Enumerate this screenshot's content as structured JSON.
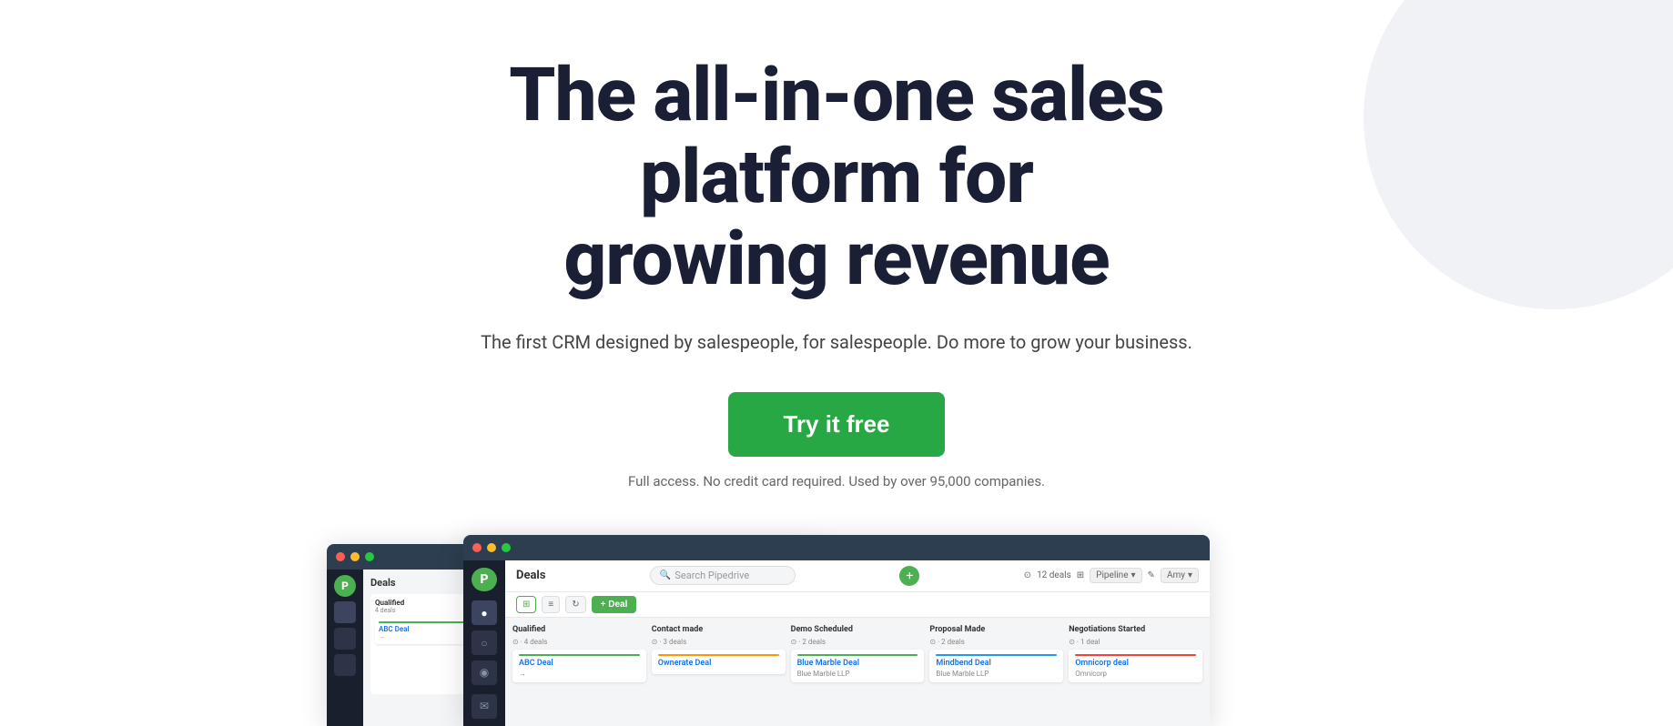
{
  "hero": {
    "title_line1": "The all-in-one sales platform for",
    "title_line2": "growing revenue",
    "subtitle": "The first CRM designed by salespeople, for salespeople. Do more to grow your business.",
    "cta_button": "Try it free",
    "fine_print": "Full access. No credit card required. Used by over 95,000 companies."
  },
  "crm_preview": {
    "window_title": "Deals",
    "search_placeholder": "Search Pipedrive",
    "add_btn": "+",
    "stats": "12 deals",
    "pipeline_label": "Pipeline",
    "user_label": "Amy",
    "toolbar_items": [
      "grid-icon",
      "list-icon",
      "refresh-icon"
    ],
    "add_deal_btn": "+ Deal",
    "columns": [
      {
        "name": "Qualified",
        "count": "4 deals",
        "cards": [
          {
            "title": "ABC Deal",
            "sub": "",
            "indicator": "green"
          }
        ]
      },
      {
        "name": "Contact made",
        "count": "3 deals",
        "cards": [
          {
            "title": "Ownerate Deal",
            "sub": "",
            "indicator": "orange"
          }
        ]
      },
      {
        "name": "Demo Scheduled",
        "count": "2 deals",
        "cards": [
          {
            "title": "Blue Marble Deal",
            "sub": "Blue Marble LLP",
            "indicator": "green"
          }
        ]
      },
      {
        "name": "Proposal Made",
        "count": "2 deals",
        "cards": [
          {
            "title": "Mindbend Deal",
            "sub": "Blue Marble LLP",
            "indicator": "blue"
          }
        ]
      },
      {
        "name": "Negotiations Started",
        "count": "1 deal",
        "cards": [
          {
            "title": "Omnicorp deal",
            "sub": "Omnicorp",
            "indicator": "red"
          }
        ]
      }
    ],
    "sidebar_logo": "P",
    "sidebar_icons": [
      "●",
      "○",
      "◉",
      "✉"
    ]
  },
  "colors": {
    "cta_bg": "#28a745",
    "cta_text": "#ffffff",
    "title_color": "#1a1f36",
    "subtitle_color": "#444444",
    "fine_print_color": "#666666",
    "bg_circle": "#f0f2f5"
  }
}
